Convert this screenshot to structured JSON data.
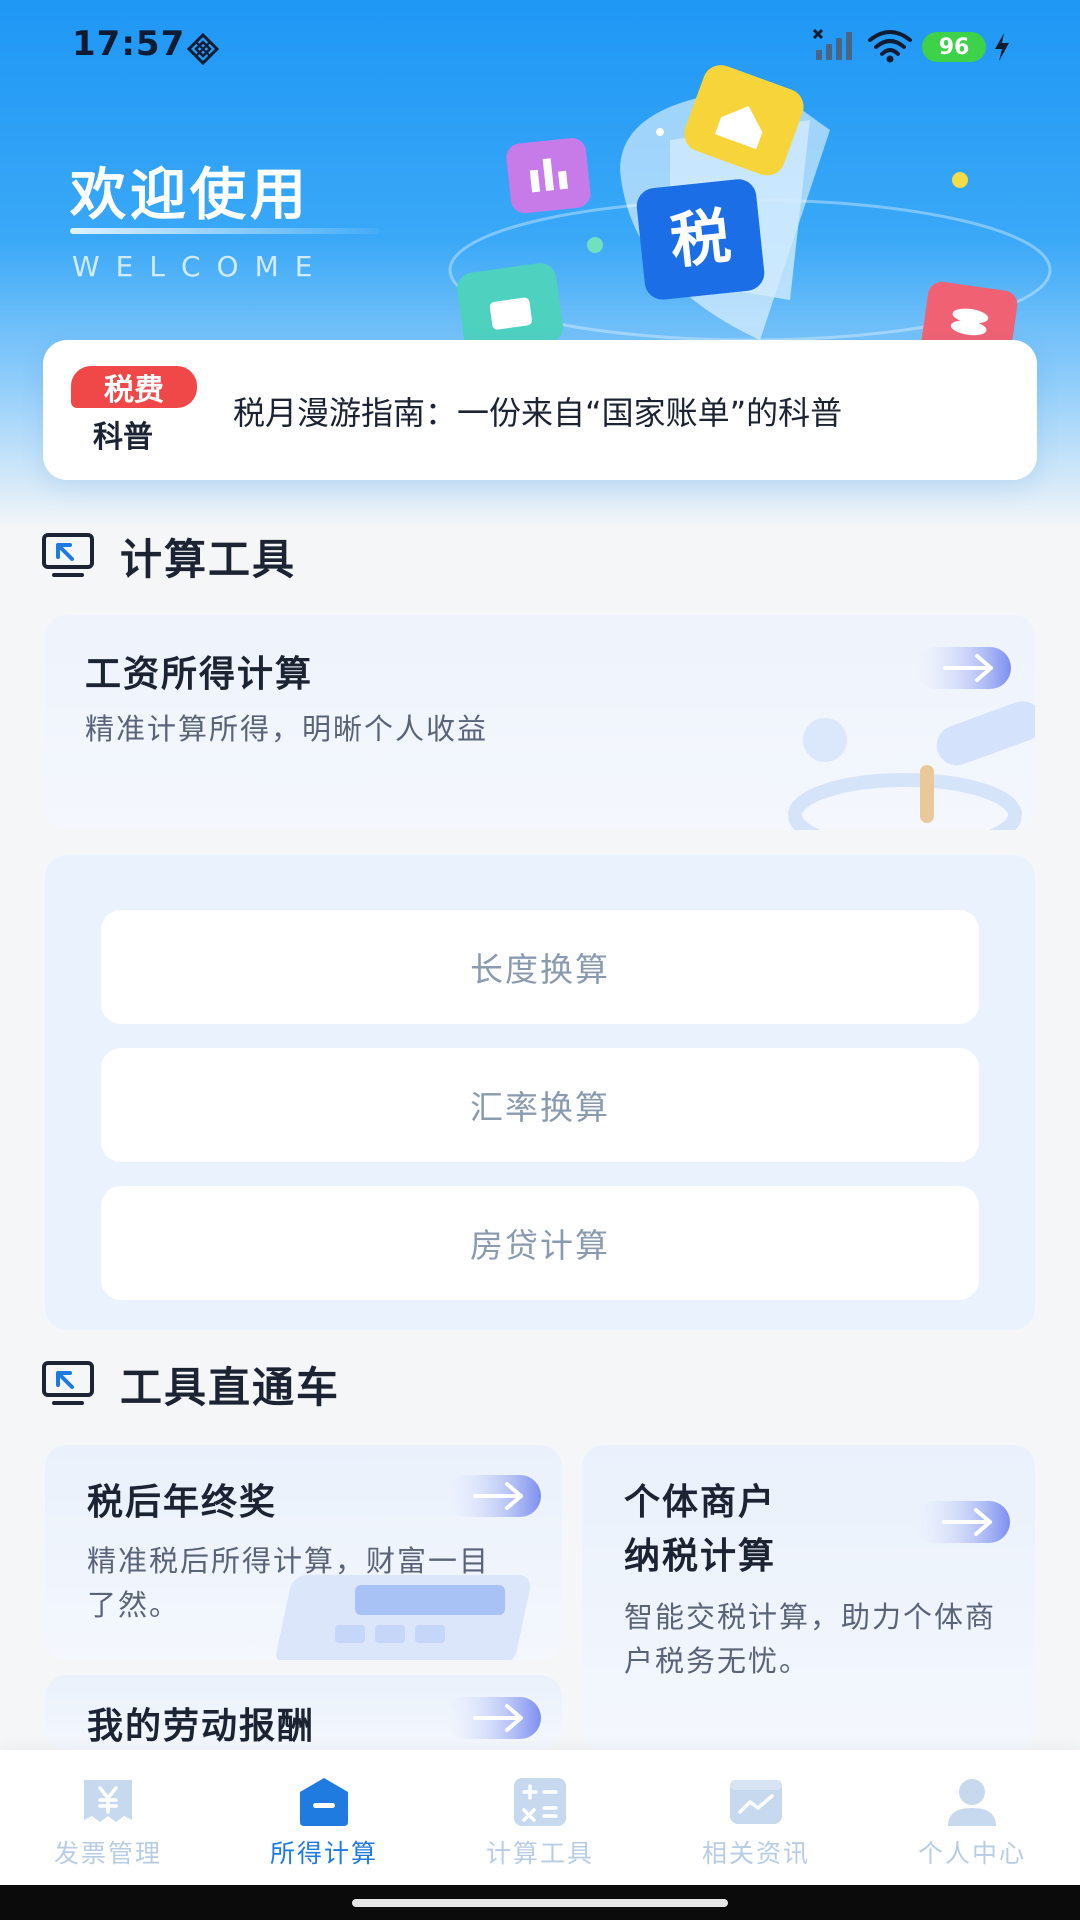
{
  "status_bar": {
    "time": "17:57",
    "battery": "96"
  },
  "hero": {
    "title": "欢迎使用",
    "subtitle": "WELCOME",
    "tax_tile": "税"
  },
  "notice": {
    "badge_top": "税费",
    "badge_bottom": "科普",
    "text": "税月漫游指南：一份来自“国家账单”的科普"
  },
  "sections": {
    "calc_tools": "计算工具",
    "direct": "工具直通车"
  },
  "salary_card": {
    "title": "工资所得计算",
    "desc": "精准计算所得，明晰个人收益"
  },
  "tool_buttons": [
    "长度换算",
    "汇率换算",
    "房贷计算"
  ],
  "direct_cards": [
    {
      "title": "税后年终奖",
      "desc": "精准税后所得计算，财富一目了然。"
    },
    {
      "title_line1": "个体商户",
      "title_line2": "纳税计算",
      "desc": "智能交税计算，助力个体商户税务无忧。"
    },
    {
      "title": "我的劳动报酬"
    }
  ],
  "tabbar": {
    "tabs": [
      {
        "label": "发票管理",
        "icon": "invoice-icon"
      },
      {
        "label": "所得计算",
        "icon": "income-icon"
      },
      {
        "label": "计算工具",
        "icon": "calculator-icon"
      },
      {
        "label": "相关资讯",
        "icon": "news-icon"
      },
      {
        "label": "个人中心",
        "icon": "user-icon"
      }
    ],
    "active_index": 1
  },
  "colors": {
    "primary": "#1f7be0",
    "hero_blue": "#1e97f5",
    "badge_red": "#f04848",
    "battery_green": "#3dd24a",
    "inactive_tab": "#b8cde3"
  }
}
